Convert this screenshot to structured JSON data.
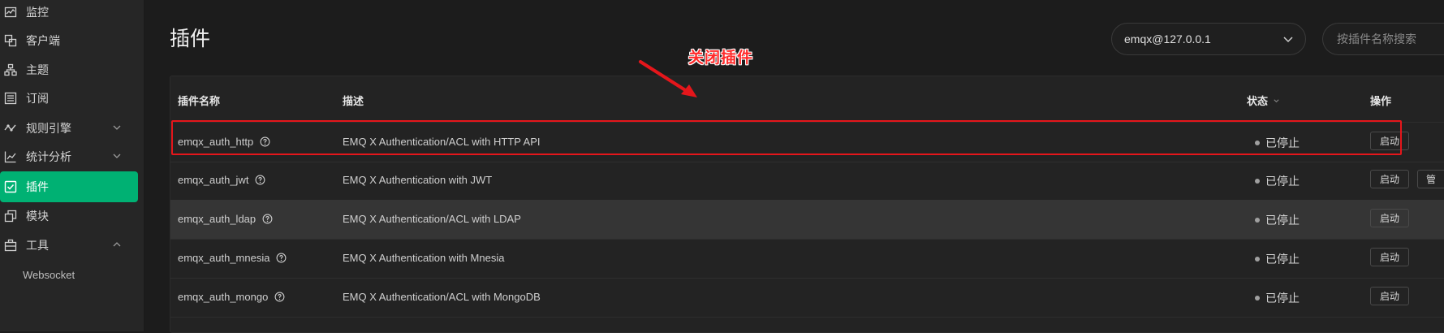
{
  "sidebar": {
    "items": [
      {
        "label": "监控",
        "icon": "monitor-icon"
      },
      {
        "label": "客户端",
        "icon": "clients-icon"
      },
      {
        "label": "主题",
        "icon": "topics-icon"
      },
      {
        "label": "订阅",
        "icon": "subscriptions-icon"
      },
      {
        "label": "规则引擎",
        "icon": "rule-engine-icon",
        "expand": "down"
      },
      {
        "label": "统计分析",
        "icon": "analytics-icon",
        "expand": "down"
      },
      {
        "label": "插件",
        "icon": "plugins-icon",
        "active": true
      },
      {
        "label": "模块",
        "icon": "modules-icon"
      },
      {
        "label": "工具",
        "icon": "tools-icon",
        "expand": "up"
      }
    ],
    "sub_item": "Websocket",
    "accent": "#00b173"
  },
  "header": {
    "title": "插件",
    "node_select": "emqx@127.0.0.1",
    "search_placeholder": "按插件名称搜索"
  },
  "table": {
    "columns": {
      "name": "插件名称",
      "desc": "描述",
      "status": "状态",
      "actions": "操作"
    },
    "rows": [
      {
        "name": "emqx_auth_http",
        "desc": "EMQ X Authentication/ACL with HTTP API",
        "status": "已停止",
        "action": "启动"
      },
      {
        "name": "emqx_auth_jwt",
        "desc": "EMQ X Authentication with JWT",
        "status": "已停止",
        "action": "启动",
        "manage": "管"
      },
      {
        "name": "emqx_auth_ldap",
        "desc": "EMQ X Authentication/ACL with LDAP",
        "status": "已停止",
        "action": "启动"
      },
      {
        "name": "emqx_auth_mnesia",
        "desc": "EMQ X Authentication with Mnesia",
        "status": "已停止",
        "action": "启动"
      },
      {
        "name": "emqx_auth_mongo",
        "desc": "EMQ X Authentication/ACL with MongoDB",
        "status": "已停止",
        "action": "启动"
      }
    ]
  },
  "annotation": {
    "text": "关闭插件",
    "color": "#e5161b"
  }
}
